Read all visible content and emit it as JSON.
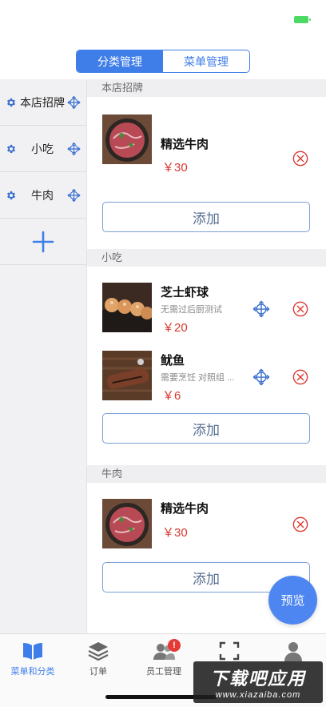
{
  "segment": {
    "tabs": [
      {
        "label": "分类管理",
        "active": true
      },
      {
        "label": "菜单管理",
        "active": false
      }
    ]
  },
  "sidebar": {
    "categories": [
      {
        "label": "本店招牌",
        "icon": "gear-icon",
        "move_icon": "move-icon"
      },
      {
        "label": "小吃",
        "icon": "gear-icon",
        "move_icon": "move-icon"
      },
      {
        "label": "牛肉",
        "icon": "gear-icon",
        "move_icon": "move-icon"
      }
    ],
    "add_icon": "plus-icon"
  },
  "sections": [
    {
      "title": "本店招牌",
      "items": [
        {
          "name": "精选牛肉",
          "desc": "",
          "price": "￥30",
          "image": "beef"
        }
      ],
      "add_label": "添加"
    },
    {
      "title": "小吃",
      "items": [
        {
          "name": "芝士虾球",
          "desc": "无需过后厨测试",
          "price": "￥20",
          "image": "shrimp-balls"
        },
        {
          "name": "鱿鱼",
          "desc": "需要烹饪 对照组 ...",
          "price": "￥6",
          "image": "squid"
        }
      ],
      "add_label": "添加"
    },
    {
      "title": "牛肉",
      "items": [
        {
          "name": "精选牛肉",
          "desc": "",
          "price": "￥30",
          "image": "beef"
        }
      ],
      "add_label": "添加"
    }
  ],
  "preview_button": {
    "label": "预览"
  },
  "tabbar": {
    "tabs": [
      {
        "label": "菜单和分类",
        "icon": "book-icon",
        "active": true
      },
      {
        "label": "订单",
        "icon": "layers-icon",
        "active": false
      },
      {
        "label": "员工管理",
        "icon": "users-icon",
        "active": false,
        "badge": "!"
      },
      {
        "label": "",
        "icon": "scan-icon",
        "active": false
      },
      {
        "label": "",
        "icon": "person-icon",
        "active": false
      }
    ]
  },
  "watermark": {
    "line1": "下载吧应用",
    "line2": "www.xiazaiba.com"
  },
  "colors": {
    "accent": "#3f7ee8",
    "price": "#d9372f",
    "delete": "#d9372f",
    "sidebar_bg": "#f1f1f3",
    "section_bg": "#efeff2",
    "preview_bg": "#4d86f0"
  }
}
